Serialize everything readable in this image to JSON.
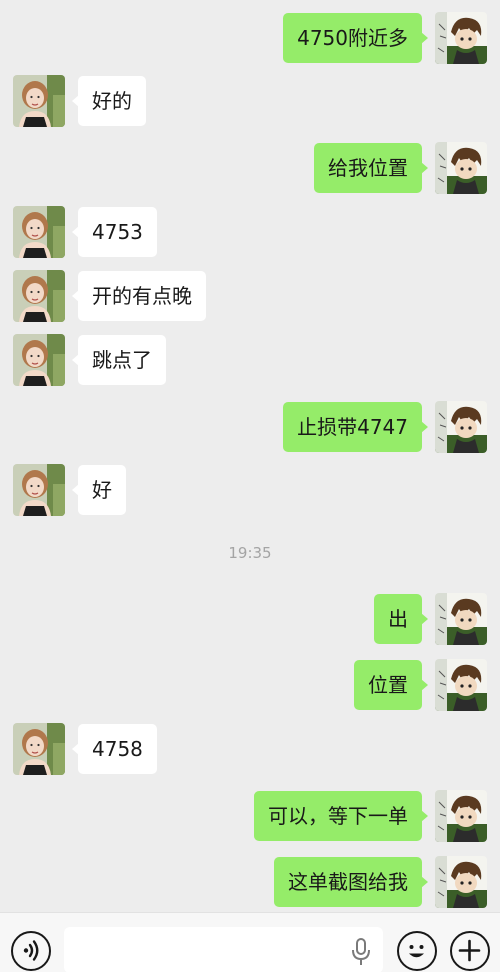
{
  "chat": {
    "messages": [
      {
        "side": "right",
        "text": "4750附近多"
      },
      {
        "side": "left",
        "text": "好的"
      },
      {
        "side": "right",
        "text": "给我位置"
      },
      {
        "side": "left",
        "text": "4753"
      },
      {
        "side": "left",
        "text": "开的有点晚"
      },
      {
        "side": "left",
        "text": "跳点了"
      },
      {
        "side": "right",
        "text": "止损带4747"
      },
      {
        "side": "left",
        "text": "好"
      },
      {
        "side": "right",
        "text": "出"
      },
      {
        "side": "right",
        "text": "位置"
      },
      {
        "side": "left",
        "text": "4758"
      },
      {
        "side": "right",
        "text": "可以，等下一单"
      },
      {
        "side": "right",
        "text": "这单截图给我"
      }
    ],
    "timestamp": "19:35"
  },
  "input_bar": {
    "voice_icon": "voice-wave-icon",
    "text_value": "",
    "mic_icon": "microphone-icon",
    "emoji_icon": "emoji-face-icon",
    "plus_icon": "plus-icon"
  },
  "colors": {
    "background": "#ededed",
    "sent_bubble": "#95ec69",
    "received_bubble": "#ffffff",
    "timestamp_text": "#a4a4a4"
  }
}
